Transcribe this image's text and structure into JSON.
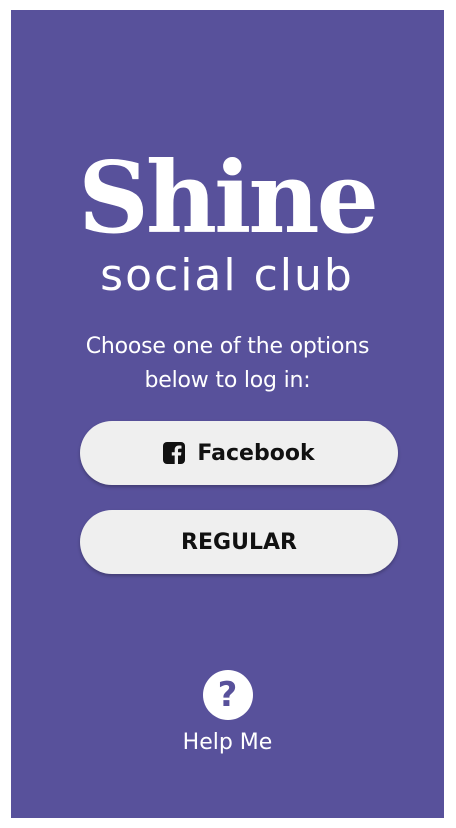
{
  "app": {
    "background_color": "#58519b",
    "logo": {
      "title": "Shine",
      "subtitle": "social club"
    }
  },
  "login": {
    "prompt_line1": "Choose one of the options",
    "prompt_line2": "below to log in:",
    "facebook_button": {
      "label": "Facebook",
      "icon": "facebook-icon"
    },
    "regular_button": {
      "label": "REGULAR"
    }
  },
  "help": {
    "icon": "question-icon",
    "icon_glyph": "?",
    "label": "Help Me"
  }
}
